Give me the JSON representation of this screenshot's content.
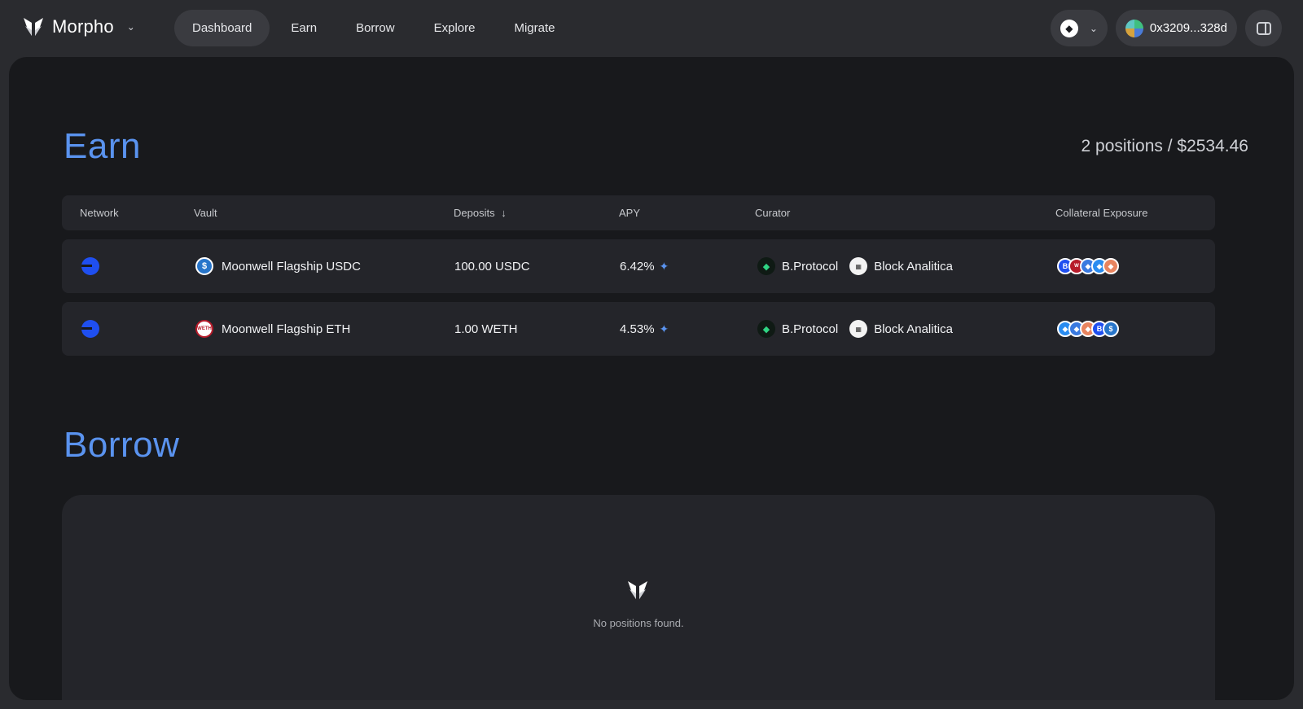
{
  "header": {
    "brand": "Morpho",
    "nav": [
      {
        "label": "Dashboard",
        "active": true
      },
      {
        "label": "Earn",
        "active": false
      },
      {
        "label": "Borrow",
        "active": false
      },
      {
        "label": "Explore",
        "active": false
      },
      {
        "label": "Migrate",
        "active": false
      }
    ],
    "network_icon": "ethereum-icon",
    "wallet_address": "0x3209...328d"
  },
  "earn": {
    "title": "Earn",
    "summary": "2 positions / $2534.46",
    "columns": [
      "Network",
      "Vault",
      "Deposits",
      "APY",
      "Curator",
      "Collateral Exposure"
    ],
    "sort_indicator": "↓",
    "rows": [
      {
        "network_icon": "base-network-icon",
        "vault": "Moonwell Flagship USDC",
        "vault_token_icon": "usdc-icon",
        "deposits": "100.00 USDC",
        "apy": "6.42%",
        "curators": [
          "B.Protocol",
          "Block Analitica"
        ],
        "collateral_icons": [
          "cbbtc",
          "weth",
          "wsteth",
          "cbeth",
          "reth"
        ]
      },
      {
        "network_icon": "base-network-icon",
        "vault": "Moonwell Flagship ETH",
        "vault_token_icon": "weth-icon",
        "deposits": "1.00 WETH",
        "apy": "4.53%",
        "curators": [
          "B.Protocol",
          "Block Analitica"
        ],
        "collateral_icons": [
          "wsteth",
          "cbeth",
          "reth",
          "cbbtc",
          "usdc"
        ]
      }
    ]
  },
  "borrow": {
    "title": "Borrow",
    "empty_text": "No positions found."
  },
  "colors": {
    "accent": "#5a93ef",
    "base_blue": "#1f4ff0",
    "card_bg": "#18191c",
    "row_bg": "#24252a"
  }
}
